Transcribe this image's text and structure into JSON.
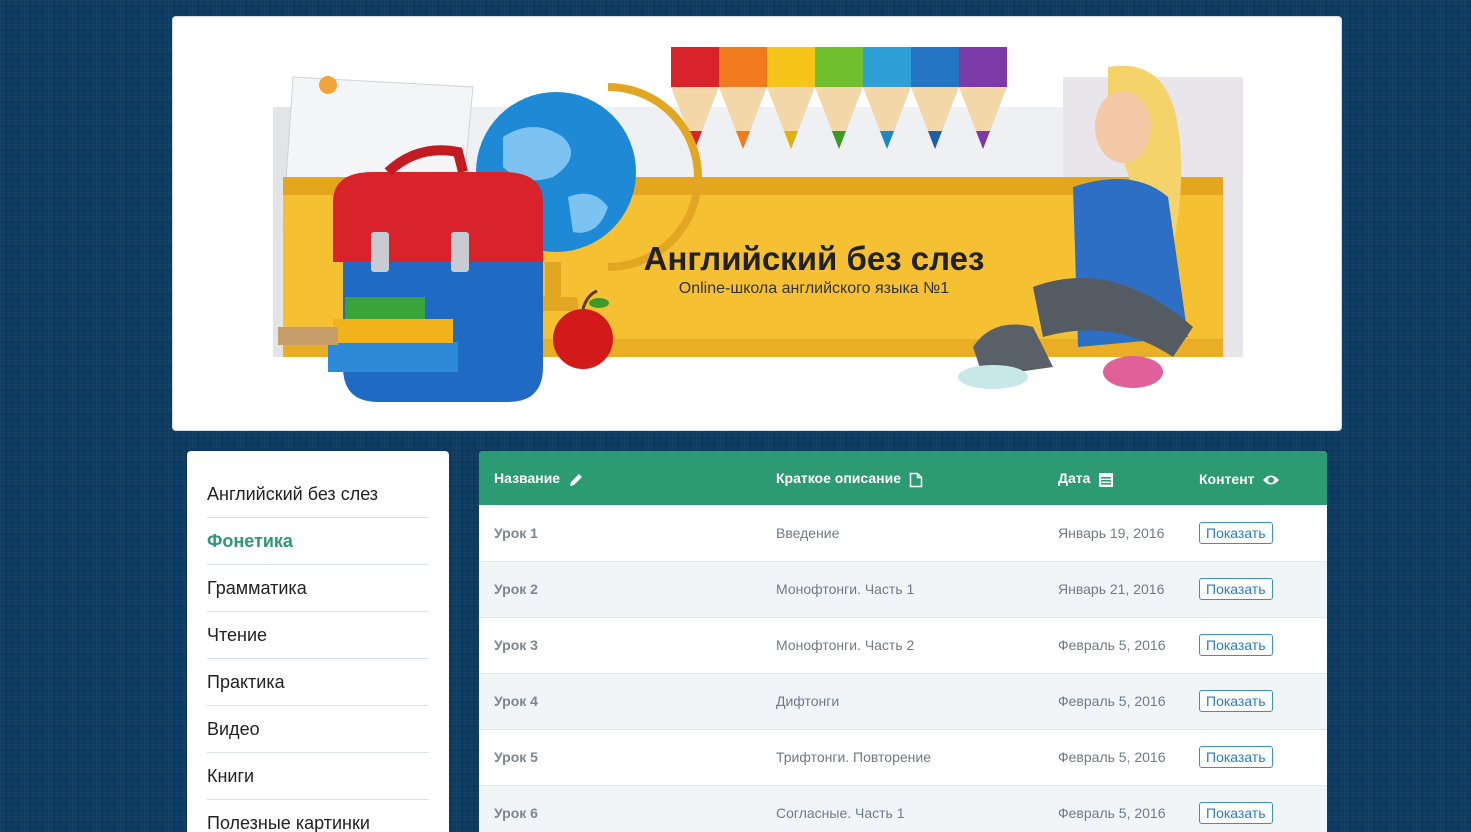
{
  "header": {
    "title": "Английский без слез",
    "subtitle": "Online-школа английского языка №1"
  },
  "sidebar": {
    "items": [
      {
        "label": "Английский без слез",
        "active": false
      },
      {
        "label": "Фонетика",
        "active": true
      },
      {
        "label": "Грамматика",
        "active": false
      },
      {
        "label": "Чтение",
        "active": false
      },
      {
        "label": "Практика",
        "active": false
      },
      {
        "label": "Видео",
        "active": false
      },
      {
        "label": "Книги",
        "active": false
      },
      {
        "label": "Полезные картинки",
        "active": false
      }
    ]
  },
  "table": {
    "columns": [
      {
        "label": "Название",
        "icon": "pencil-icon"
      },
      {
        "label": "Краткое описание",
        "icon": "document-icon"
      },
      {
        "label": "Дата",
        "icon": "calendar-icon"
      },
      {
        "label": "Контент",
        "icon": "eye-icon"
      }
    ],
    "rows": [
      {
        "name": "Урок 1",
        "description": "Введение",
        "date": "Январь 19, 2016",
        "action": "Показать"
      },
      {
        "name": "Урок 2",
        "description": "Монофтонги. Часть 1",
        "date": "Январь 21, 2016",
        "action": "Показать"
      },
      {
        "name": "Урок 3",
        "description": "Монофтонги. Часть 2",
        "date": "Февраль 5, 2016",
        "action": "Показать"
      },
      {
        "name": "Урок 4",
        "description": "Дифтонги",
        "date": "Февраль 5, 2016",
        "action": "Показать"
      },
      {
        "name": "Урок 5",
        "description": "Трифтонги. Повторение",
        "date": "Февраль 5, 2016",
        "action": "Показать"
      },
      {
        "name": "Урок 6",
        "description": "Согласные. Часть 1",
        "date": "Февраль 5, 2016",
        "action": "Показать"
      }
    ]
  },
  "colors": {
    "background": "#0d3e66",
    "table_header": "#2c9a72",
    "active_menu": "#2a9a70",
    "button_text": "#2a7dc4"
  }
}
